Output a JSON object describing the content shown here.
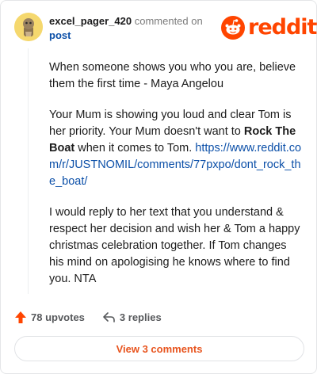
{
  "header": {
    "author": "excel_pager_420",
    "meta": "commented on",
    "post_link": "post",
    "logo_text": "reddit"
  },
  "comment": {
    "p1": "When someone shows you who you are, believe them the first time - Maya Angelou",
    "p2_before": "Your Mum is showing you loud and clear Tom is her priority. Your Mum doesn't want to ",
    "p2_bold": "Rock The Boat",
    "p2_after": " when it comes to Tom. ",
    "p2_link": "https://www.reddit.com/r/JUSTNOMIL/comments/77pxpo/dont_rock_the_boat/",
    "p3": "I would reply to her text that you understand & respect her decision and wish her & Tom a happy christmas celebration together. If Tom changes his mind on apologising he knows where to find you. NTA"
  },
  "actions": {
    "upvotes": "78 upvotes",
    "replies": "3 replies"
  },
  "view_button": "View 3 comments",
  "colors": {
    "accent": "#ff4500",
    "link": "#0b4fa8",
    "view_button_text": "#e8541e",
    "avatar_bg": "#f5d86e"
  },
  "icons": {
    "avatar": "snoo-avatar-icon",
    "logo": "reddit-logo-icon",
    "upvote": "upvote-arrow-icon",
    "reply": "reply-arrow-icon"
  }
}
